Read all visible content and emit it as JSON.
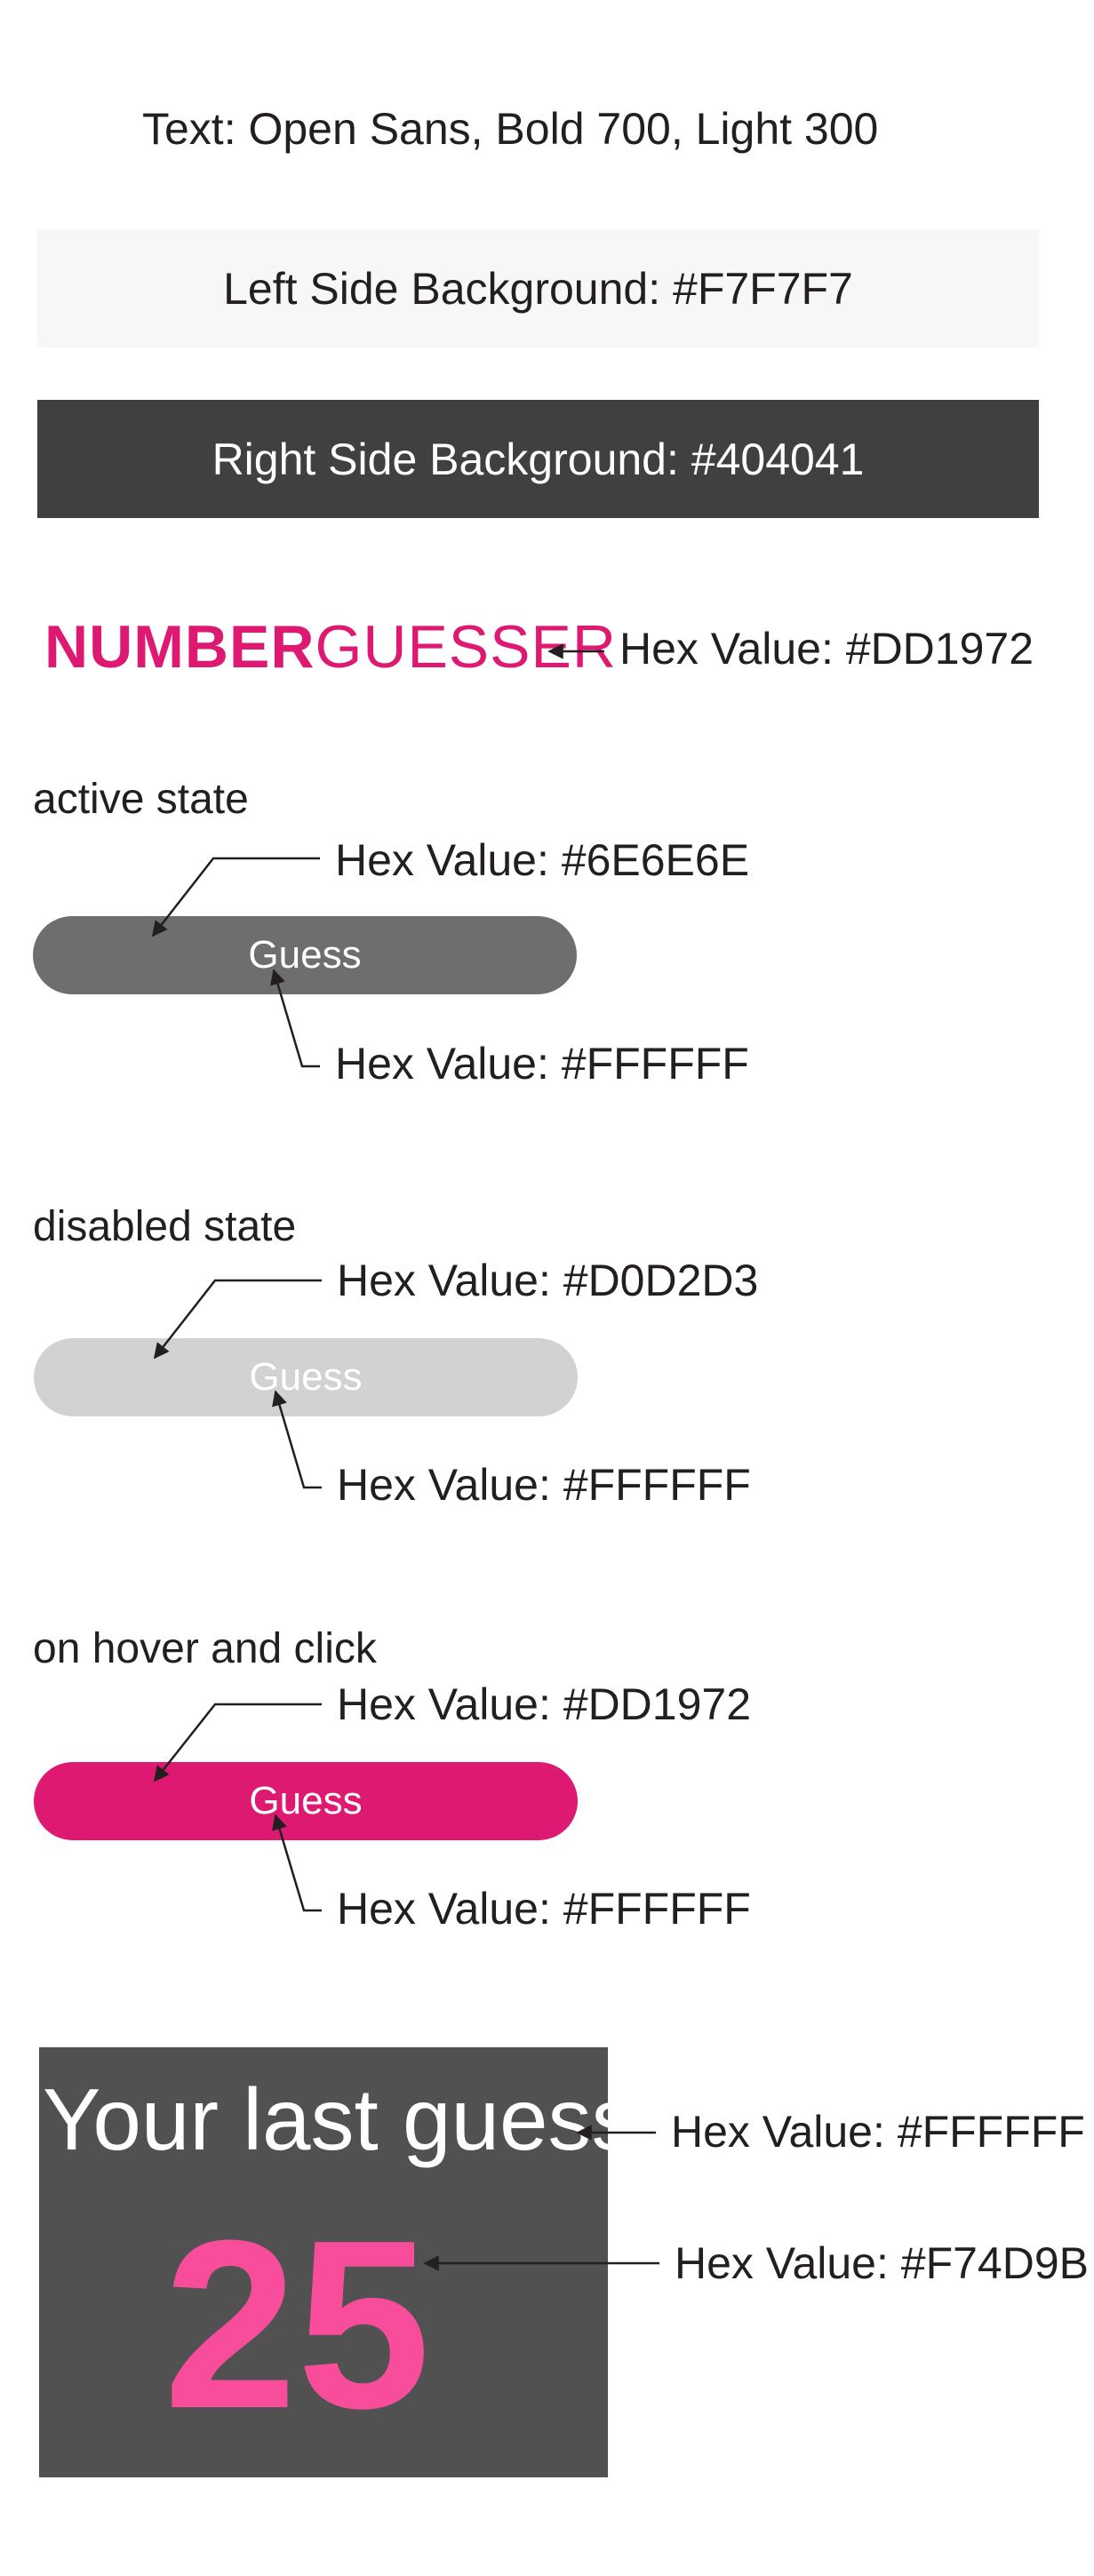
{
  "typography": {
    "text": "Text: Open Sans, Bold 700, Light 300"
  },
  "backgrounds": {
    "left": {
      "label": "Left Side Background: #F7F7F7",
      "color": "#F7F7F7"
    },
    "right": {
      "label": "Right Side Background: #404041",
      "color": "#404041"
    }
  },
  "logo": {
    "bold": "NUMBER",
    "light": "GUESSER",
    "color": "#DD1972",
    "hex_label": "Hex Value: #DD1972"
  },
  "states": {
    "active": {
      "title": "active state",
      "button_label": "Guess",
      "bg_color": "#6E6E6E",
      "bg_hex_label": "Hex Value: #6E6E6E",
      "text_color": "#FFFFFF",
      "text_hex_label": "Hex Value: #FFFFFF"
    },
    "disabled": {
      "title": "disabled state",
      "button_label": "Guess",
      "bg_color": "#D0D2D3",
      "bg_hex_label": "Hex Value: #D0D2D3",
      "text_color": "#FFFFFF",
      "text_hex_label": "Hex Value: #FFFFFF"
    },
    "hover": {
      "title": "on hover and click",
      "button_label": "Guess",
      "bg_color": "#DD1972",
      "bg_hex_label": "Hex Value: #DD1972",
      "text_color": "#FFFFFF",
      "text_hex_label": "Hex Value: #FFFFFF"
    }
  },
  "last_guess": {
    "title": "Your last guess",
    "number": "25",
    "title_color": "#FFFFFF",
    "title_hex_label": "Hex Value: #FFFFFF",
    "number_color": "#F74D9B",
    "number_hex_label": "Hex Value: #F74D9B"
  }
}
